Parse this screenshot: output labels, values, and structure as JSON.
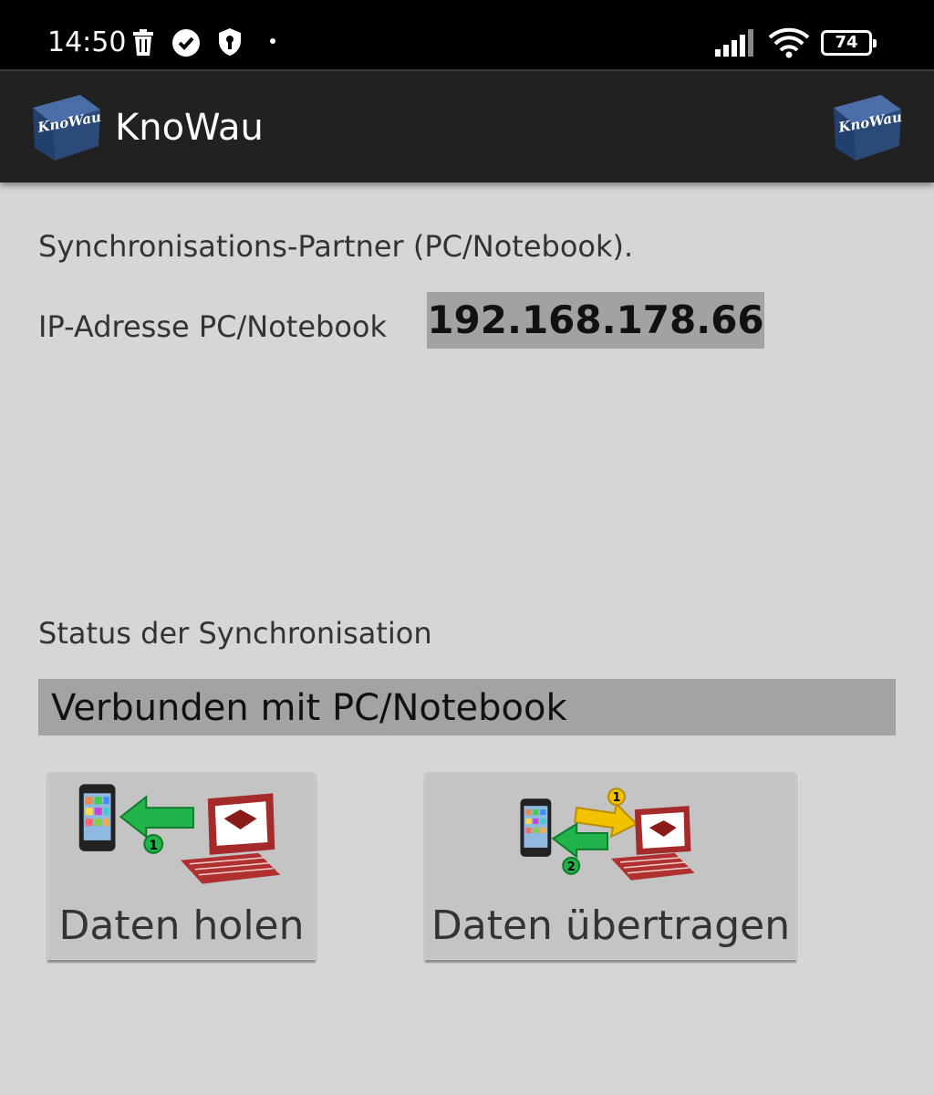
{
  "status_bar": {
    "time": "14:50",
    "battery": "74",
    "icons": [
      "trash-icon",
      "check-circle-icon",
      "shield-key-icon",
      "dot-icon",
      "signal-icon",
      "wifi-icon",
      "battery-icon"
    ]
  },
  "app_bar": {
    "title": "KnoWau",
    "logo_text": "KnoWau"
  },
  "sync": {
    "partner_label": "Synchronisations-Partner (PC/Notebook).",
    "ip_label": "IP-Adresse PC/Notebook",
    "ip_value": "192.168.178.66",
    "status_label": "Status der Synchronisation",
    "status_value": "Verbunden mit PC/Notebook"
  },
  "actions": {
    "get_label": "Daten holen",
    "send_label": "Daten übertragen",
    "step1": "1",
    "step2": "2"
  },
  "colors": {
    "green_arrow": "#22b34a",
    "yellow_arrow": "#f2c200",
    "monitor_red": "#a52a2a",
    "logo_blue": "#2c4a78"
  }
}
